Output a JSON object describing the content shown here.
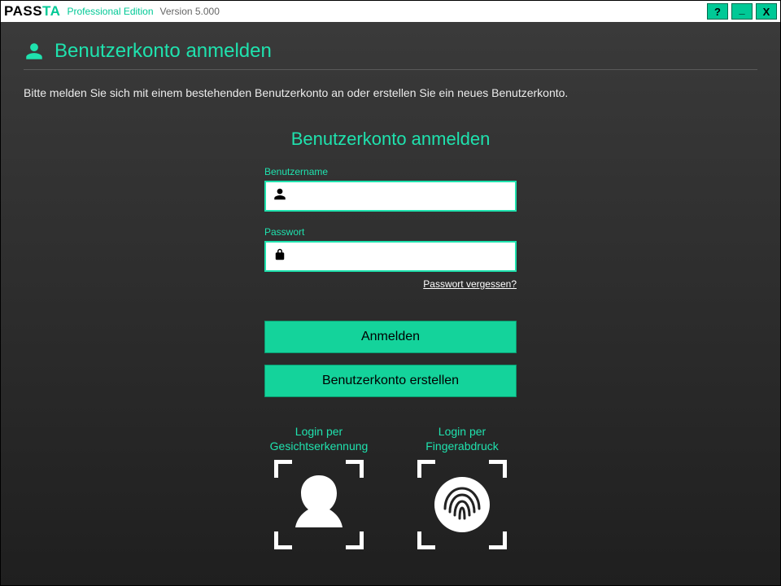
{
  "titlebar": {
    "brand_pass": "PASS",
    "brand_ta": "TA",
    "edition": "Professional Edition",
    "version": "Version 5.000",
    "help": "?",
    "minimize": "_",
    "close": "X"
  },
  "header": {
    "title": "Benutzerkonto anmelden"
  },
  "intro": "Bitte melden Sie sich mit einem bestehenden Benutzerkonto an oder erstellen Sie ein neues Benutzerkonto.",
  "login": {
    "section_title": "Benutzerkonto anmelden",
    "username_label": "Benutzername",
    "username_value": "",
    "password_label": "Passwort",
    "password_value": "",
    "forgot_link": "Passwort vergessen?",
    "login_button": "Anmelden",
    "create_button": "Benutzerkonto erstellen"
  },
  "biometric": {
    "face_label": "Login per\nGesichtserkennung",
    "finger_label": "Login per\nFingerabdruck"
  }
}
